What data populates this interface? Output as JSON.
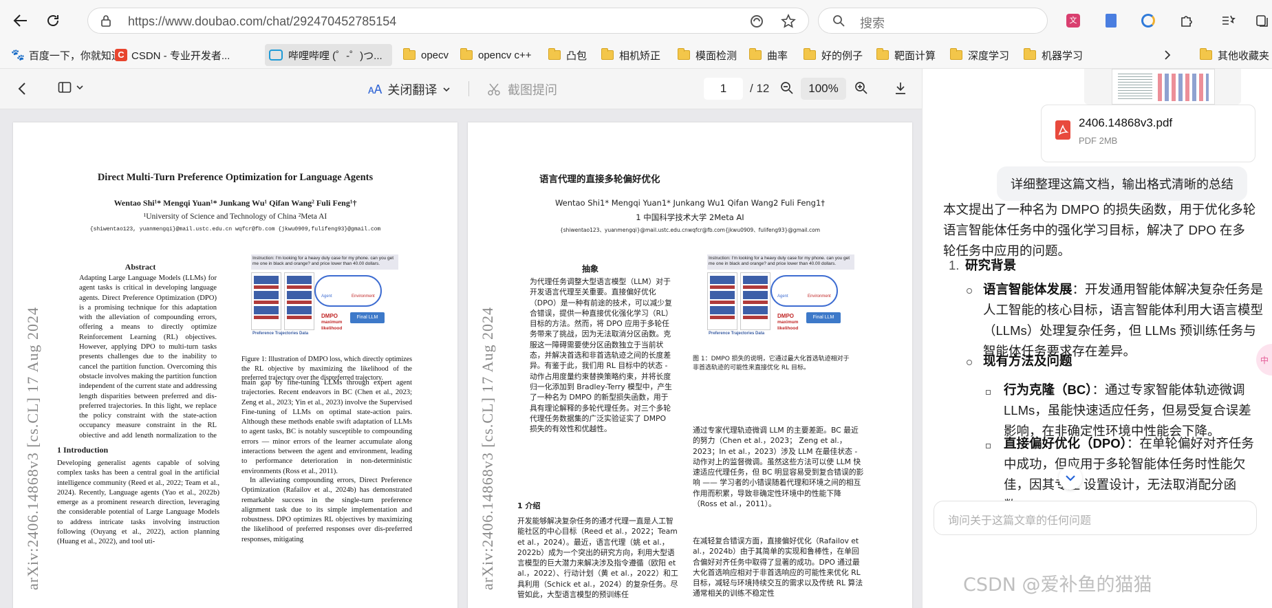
{
  "browser": {
    "url": "https://www.doubao.com/chat/292470452785154",
    "search_placeholder": "搜索",
    "colors": {
      "accent": "#1a73e8",
      "bookmark_folder": "#f3c64a"
    }
  },
  "bookmarks": [
    {
      "label": "百度一下，你就知道",
      "icon": "baidu-icon"
    },
    {
      "label": "CSDN - 专业开发者...",
      "icon": "csdn-icon"
    },
    {
      "label": "哔哩哔哩 (゜-゜)つ...",
      "icon": "bilibili-icon"
    },
    {
      "label": "opecv",
      "icon": "folder-icon"
    },
    {
      "label": "opencv c++",
      "icon": "folder-icon"
    },
    {
      "label": "凸包",
      "icon": "folder-icon"
    },
    {
      "label": "相机矫正",
      "icon": "folder-icon"
    },
    {
      "label": "模面检测",
      "icon": "folder-icon"
    },
    {
      "label": "曲率",
      "icon": "folder-icon"
    },
    {
      "label": "好的例子",
      "icon": "folder-icon"
    },
    {
      "label": "靶面计算",
      "icon": "folder-icon"
    },
    {
      "label": "深度学习",
      "icon": "folder-icon"
    },
    {
      "label": "机器学习",
      "icon": "folder-icon"
    }
  ],
  "bookmarks_other": "其他收藏夹",
  "pdf_toolbar": {
    "translate_label": "关闭翻译",
    "screenshot_label": "截图提问",
    "current_page": "1",
    "total_pages": "/ 12",
    "zoom": "100%"
  },
  "paper": {
    "title": "Direct Multi-Turn Preference Optimization for Language Agents",
    "authors": "Wentao Shi¹* Mengqi Yuan¹* Junkang Wu¹ Qifan Wang² Fuli Feng¹†",
    "affiliation": "¹University of Science and Technology of China    ²Meta AI",
    "emails": "{shiwentao123, yuanmengqi}@mail.ustc.edu.cn   wqfcr@fb.com   {jkwu0909,fulifeng93}@gmail.com",
    "arxiv_stamp": "arXiv:2406.14868v3  [cs.CL]  17 Aug 2024",
    "abstract_heading": "Abstract",
    "abstract": "Adapting Large Language Models (LLMs) for agent tasks is critical in developing language agents. Direct Preference Optimization (DPO) is a promising technique for this adaptation with the alleviation of compounding errors, offering a means to directly optimize Reinforcement Learning (RL) objectives. However, applying DPO to multi-turn tasks presents challenges due to the inability to cancel the partition function. Overcoming this obstacle involves making the partition function independent of the current state and addressing length disparities between preferred and dis-preferred trajectories. In this light, we replace the policy constraint with the state-action occupancy measure constraint in the RL objective and add length normalization to the Bradley-Terry model, yielding a novel loss function named DMPO for multi-turn agent tasks with theoretical explanations. Extensive experiments on three multi-turn agent task datasets confirm the effectiveness and superiority of the DMPO loss.",
    "figure_instruction": "Instruction: I'm looking for a heavy duty case for my phone. can you get me one in black and orange? and price lower than 40.00 dollars.",
    "figure_labels": {
      "action": "Action:",
      "observ": "Observ",
      "agent": "Agent",
      "environment": "Environment",
      "dmpo": "DMPO",
      "maximum": "maximum",
      "likelihood": "likelihood",
      "final_llm": "Final LLM",
      "pref": "Preference Trajectories Data"
    },
    "figure_caption": "Figure 1: Illustration of DMPO loss, which directly optimizes the RL objective by maximizing the likelihood of the preferred trajectory over the dispreferred trajectory.",
    "intro_heading": "1    Introduction",
    "intro_left": "Developing generalist agents capable of solving complex tasks has been a central goal in the artificial intelligence community (Reed et al., 2022; Team et al., 2024). Recently, Language agents (Yao et al., 2022b) emerge as a prominent research direction, leveraging the considerable potential of Large Language Models to address intricate tasks involving instruction following (Ouyang et al., 2022), action planning (Huang et al., 2022), and tool uti-",
    "intro_right_1": "main gap by fine-tuning LLMs through expert agent trajectories. Recent endeavors in BC (Chen et al., 2023; Zeng et al., 2023; Yin et al., 2023) involve the Supervised Fine-tuning of LLMs on optimal state-action pairs. Although these methods enable swift adaptation of LLMs to agent tasks, BC is notably susceptible to compounding errors — minor errors of the learner accumulate along interactions between the agent and environment, leading to performance deterioration in non-deterministic environments (Ross et al., 2011).",
    "intro_right_2": "In alleviating compounding errors, Direct Preference Optimization (Rafailov et al., 2024b) has demonstrated remarkable success in the single-turn preference alignment task due to its simple implementation and robustness. DPO optimizes RL objectives by maximizing the likelihood of preferred responses over dis-preferred responses, mitigating"
  },
  "paper_cn": {
    "title": "语言代理的直接多轮偏好优化",
    "authors": "Wentao Shi1* Mengqi Yuan1* Junkang Wu1 Qifan Wang2 Fuli Feng1†",
    "affiliation": "1 中国科学技术大学 2Meta AI",
    "emails": "{shiwentao123、yuanmengqi}@mail.ustc.edu.cnwqfcr@fb.com{jkwu0909、fulifeng93}@gmail.com",
    "emails_link": "gmail.com",
    "arxiv_stamp": "arXiv:2406.14868v3  [cs.CL]  17 Aug 2024",
    "abstract_heading": "抽象",
    "abstract": "为代理任务调整大型语言模型（LLM）对于开发语言代理至关重要。直接偏好优化（DPO）是一种有前途的技术，可以减少复合错误，提供一种直接优化强化学习（RL）目标的方法。然而，将 DPO 应用于多轮任务带来了挑战，因为无法取消分区函数。克服这一障碍需要使分区函数独立于当前状态，并解决首选和非首选轨迹之间的长度差异。有鉴于此，我们用 RL 目标中的状态 - 动作占用度量约束替换策略约束，并将长度归一化添加到 Bradley-Terry 模型中，产生了一种名为 DMPO 的新型损失函数，用于具有理论解释的多轮代理任务。对三个多轮代理任务数据集的广泛实验证实了 DMPO 损失的有效性和优越性。",
    "figure_caption": "图 1：DMPO 损失的说明，它通过最大化首选轨迹相对于非首选轨迹的可能性来直接优化 RL 目标。",
    "intro_heading": "1 介绍",
    "intro_left": "开发能够解决复杂任务的通才代理一直是人工智能社区的中心目标（Reed et al.，2022；Team et al.，2024）。最近，语言代理（姚 et al.，2022b）成为一个突出的研究方向，利用大型语言模型的巨大潜力来解决涉及指令遵循（欧阳 et al.，2022）、行动计划（黄 et al.，2022）和工具利用（Schick et al.，2024）的复杂任务。尽管如此，大型语言模型的预训练任",
    "intro_right_1": "通过专家代理轨迹微调 LLM 的主要差距。BC 最近的努力（Chen et al.，2023； Zeng et al.，2023；In et al.，2023）涉及 LLM 在最佳状态 - 动作对上的监督微调。虽然这些方法可以使 LLM 快速适应代理任务，但 BC 明显容易受到复合错误的影响 —— 学习者的小错误随着代理和环境之间的相互作用而积累，导致非确定性环境中的性能下降（Ross et al.，2011）。",
    "intro_right_2": "在减轻复合错误方面，直接偏好优化（Rafailov et al.，2024b）由于其简单的实现和鲁棒性，在单回合偏好对齐任务中取得了显著的成功。DPO 通过最大化首选响应相对于非首选响应的可能性来优化 RL 目标，减轻与环境持续交互的需求以及传统 RL 算法通常相关的训练不稳定性"
  },
  "chat": {
    "file_name": "2406.14868v3.pdf",
    "file_meta": "PDF 2MB",
    "user_message": "详细整理这篇文档，输出格式清晰的总结",
    "intro": "本文提出了一种名为 DMPO 的损失函数，用于优化多轮语言智能体任务中的强化学习目标，解决了 DPO 在多轮任务中应用的问题。",
    "section_number": "1.",
    "section_title": "研究背景",
    "b1_bold": "语言智能体发展",
    "b1_text": "：开发通用智能体解决复杂任务是人工智能的核心目标，语言智能体利用大语言模型（LLMs）处理复杂任务，但 LLMs 预训练任务与智能体任务要求存在差异。",
    "b2_bold": "现有方法及问题",
    "b2a_bold": "行为克隆（BC）",
    "b2a_text": "：通过专家智能体轨迹微调 LLMs，虽能快速适应任务，但易受复合误差影响，在非确定性环境中性能会下降。",
    "b2b_bold": "直接偏好优化（DPO）",
    "b2b_text": "：在单轮偏好对齐任务中成功，但应用于多轮智能体任务时性能欠佳，因其专注        设置设计，无法取消配分函数。",
    "input_placeholder": "询问关于这篇文章的任何问题",
    "float_label": "中",
    "watermark": "CSDN @爱补鱼的猫猫"
  }
}
